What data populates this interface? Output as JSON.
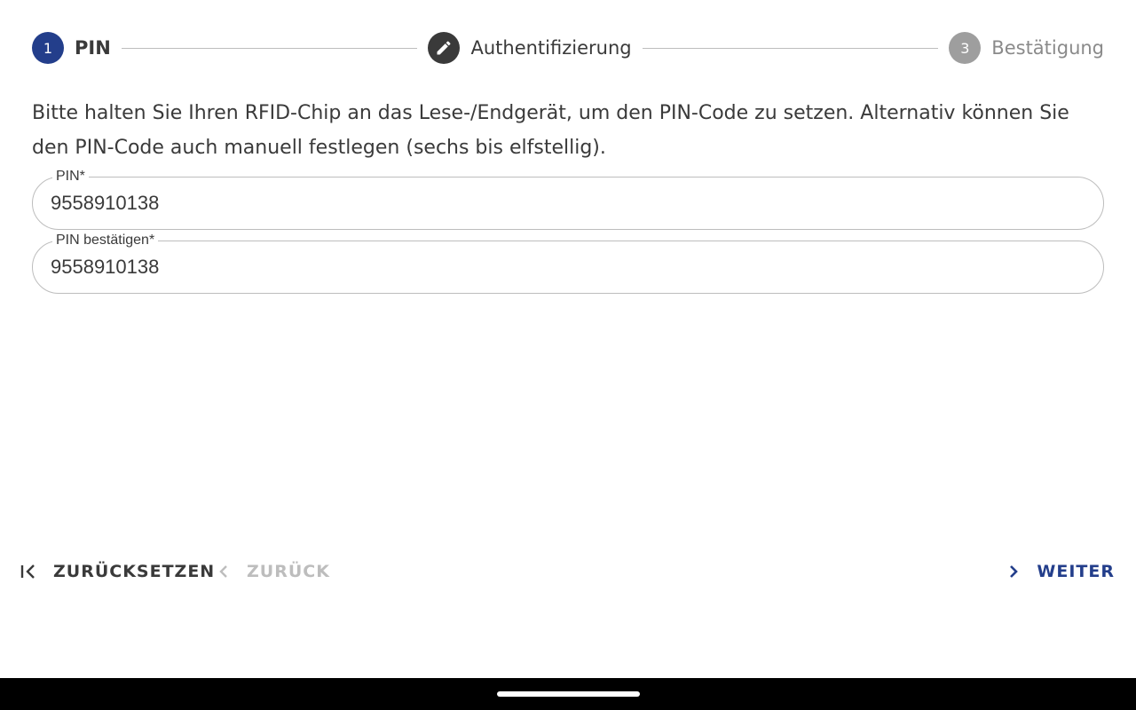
{
  "stepper": {
    "steps": [
      {
        "number": "1",
        "label": "PIN",
        "state": "active"
      },
      {
        "number": "",
        "label": "Authentifizierung",
        "state": "edit"
      },
      {
        "number": "3",
        "label": "Bestätigung",
        "state": "inactive"
      }
    ],
    "colors": {
      "active": "#233e8b",
      "edit": "#3a3a3a",
      "inactive": "#9e9e9e"
    }
  },
  "instructions": "Bitte halten Sie Ihren RFID-Chip an das Lese-/Endgerät, um den PIN-Code zu setzen. Alternativ können Sie den PIN-Code auch manuell festlegen (sechs bis elfstellig).",
  "form": {
    "pin": {
      "label": "PIN*",
      "value": "9558910138"
    },
    "pin_confirm": {
      "label": "PIN bestätigen*",
      "value": "9558910138"
    }
  },
  "actions": {
    "reset": {
      "label": "ZURÜCKSETZEN",
      "icon": "first-page-icon"
    },
    "back": {
      "label": "ZURÜCK",
      "icon": "chevron-left-icon",
      "disabled": true
    },
    "next": {
      "label": "WEITER",
      "icon": "chevron-right-icon"
    }
  },
  "system": {
    "home_indicator": "home-pill"
  }
}
